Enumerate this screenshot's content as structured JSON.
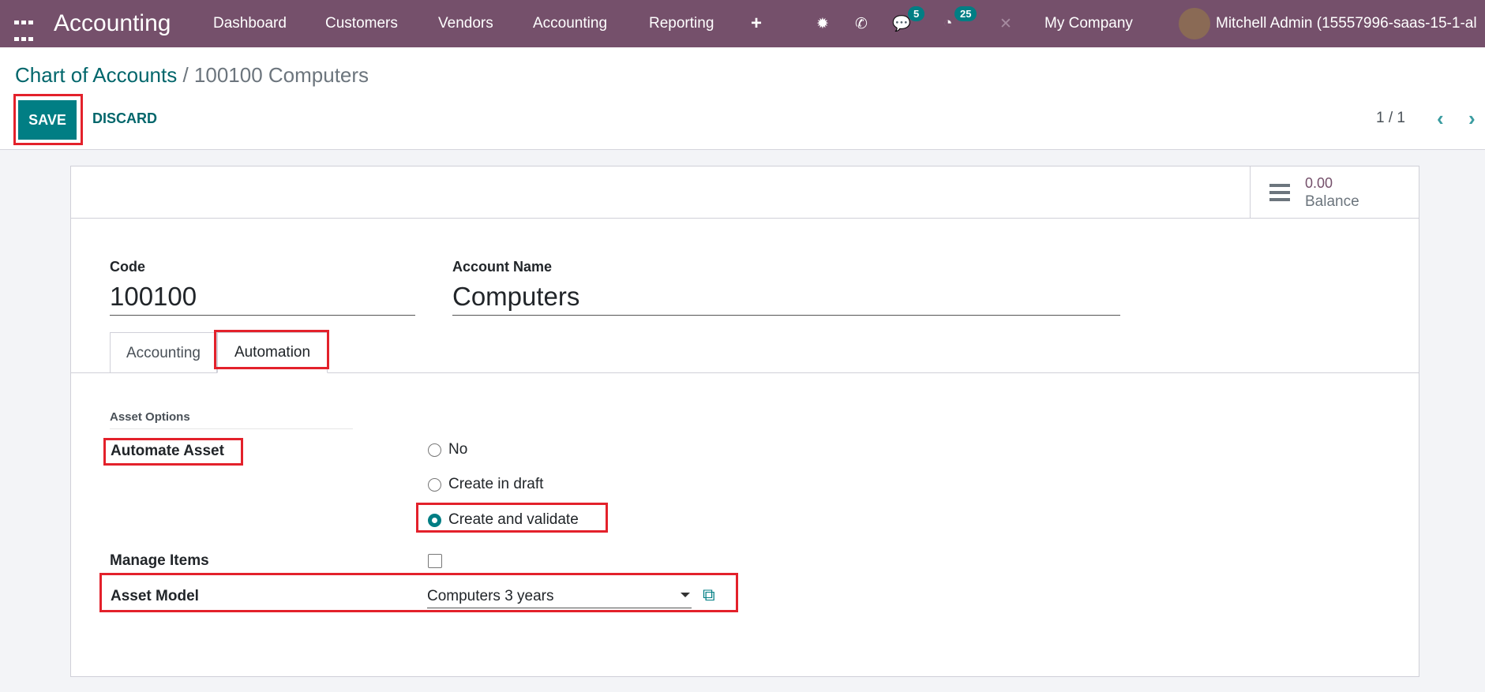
{
  "navbar": {
    "app_title": "Accounting",
    "menu": [
      "Dashboard",
      "Customers",
      "Vendors",
      "Accounting",
      "Reporting"
    ],
    "messages_count": "5",
    "activities_count": "25",
    "company": "My Company",
    "user": "Mitchell Admin (15557996-saas-15-1-al",
    "color": "#75506b"
  },
  "breadcrumb": {
    "parent": "Chart of Accounts",
    "separator": " / ",
    "current": "100100 Computers"
  },
  "toolbar": {
    "save": "SAVE",
    "discard": "DISCARD",
    "pager": "1 / 1"
  },
  "balance": {
    "value": "0.00",
    "label": "Balance"
  },
  "form": {
    "code_label": "Code",
    "code_value": "100100",
    "name_label": "Account Name",
    "name_value": "Computers",
    "tabs": [
      "Accounting",
      "Automation"
    ],
    "active_tab": "Automation",
    "section": "Asset Options",
    "automate_label": "Automate Asset",
    "automate_options": [
      "No",
      "Create in draft",
      "Create and validate"
    ],
    "automate_selected": "Create and validate",
    "manage_items_label": "Manage Items",
    "manage_items_checked": false,
    "asset_model_label": "Asset Model",
    "asset_model_value": "Computers 3 years"
  },
  "accent": "#017e84"
}
